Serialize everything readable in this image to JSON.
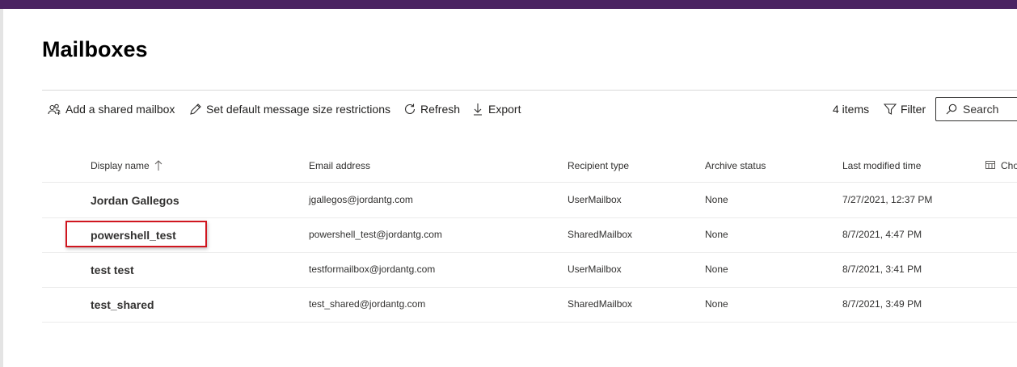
{
  "page": {
    "title": "Mailboxes"
  },
  "toolbar": {
    "add_shared": "Add a shared mailbox",
    "set_default": "Set default message size restrictions",
    "refresh": "Refresh",
    "export": "Export",
    "item_count": "4 items",
    "filter": "Filter",
    "search": "Search"
  },
  "columns": {
    "display_name": "Display name",
    "email": "Email address",
    "recipient_type": "Recipient type",
    "archive_status": "Archive status",
    "last_modified": "Last modified time",
    "choose_columns": "Cho"
  },
  "rows": [
    {
      "name": "Jordan Gallegos",
      "email": "jgallegos@jordantg.com",
      "type": "UserMailbox",
      "archive": "None",
      "modified": "7/27/2021, 12:37 PM"
    },
    {
      "name": "powershell_test",
      "email": "powershell_test@jordantg.com",
      "type": "SharedMailbox",
      "archive": "None",
      "modified": "8/7/2021, 4:47 PM"
    },
    {
      "name": "test test",
      "email": "testformailbox@jordantg.com",
      "type": "UserMailbox",
      "archive": "None",
      "modified": "8/7/2021, 3:41 PM"
    },
    {
      "name": "test_shared",
      "email": "test_shared@jordantg.com",
      "type": "SharedMailbox",
      "archive": "None",
      "modified": "8/7/2021, 3:49 PM"
    }
  ],
  "colors": {
    "top_bar": "#4b2362",
    "highlight": "#d0161f"
  },
  "icons": {
    "add_shared": "add-people-icon",
    "set_default": "pencil-icon",
    "refresh": "refresh-icon",
    "export": "download-arrow-icon",
    "filter": "funnel-icon",
    "search": "search-icon",
    "sort": "sort-ascending-arrow-icon",
    "choose_columns": "column-options-icon"
  }
}
